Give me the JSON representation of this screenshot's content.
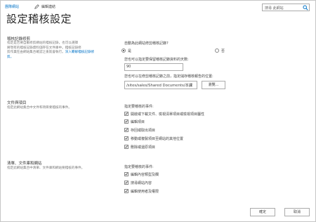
{
  "topbar": {
    "home_link": "團隊網站",
    "edit_links": "編輯連結"
  },
  "search": {
    "placeholder": "搜尋 此網站"
  },
  "page_title": "設定稽核設定",
  "sections": {
    "log_trimming": {
      "heading": "稽核記錄修剪",
      "description_parts": [
        "指定是否要自動修剪網站的稽核記錄，也可以選擇",
        "將現有的稽核記錄資料儲存在文件庫中。稽核記錄修",
        "剪作業在由網站集合確認之後就會執行。",
        "深入瞭解稽核記錄修",
        "剪。"
      ],
      "question": "自動為此網站修剪稽核記錄?",
      "radio_yes": "是",
      "radio_no": "否",
      "days_label": "您也可以指定要保留稽核記錄資料的天數:",
      "days_value": "90",
      "location_label": "您也可以在修剪稽核記錄之前，指定儲存稽核報告的位置:",
      "location_value": "/sites/sales/Shared Documents/本課",
      "browse_label": "瀏覽..."
    },
    "documents": {
      "heading": "文件與項目",
      "description": "指定此網站集合中文件和項目要稽核的事件。",
      "events_label": "指定要稽核的事件:",
      "events": [
        {
          "label": "開啟或下載文件、檢視清單項目或檢視項目屬性",
          "checked": true
        },
        {
          "label": "編輯項目",
          "checked": true
        },
        {
          "label": "存回或取出項目",
          "checked": true
        },
        {
          "label": "移動或複製項目至網站的其他位置",
          "checked": true
        },
        {
          "label": "刪除或還原項目",
          "checked": true
        }
      ]
    },
    "lists": {
      "heading": "清單、文件庫和網站",
      "description": "指定此網站集合中清單、文件庫和網站要稽核的事件。",
      "events_label": "指定要稽核的事件:",
      "events": [
        {
          "label": "編輯內容類型及欄",
          "checked": true
        },
        {
          "label": "搜尋網站內容",
          "checked": true
        },
        {
          "label": "編輯使用者及權限",
          "checked": true
        }
      ]
    }
  },
  "footer": {
    "ok_label": "確定",
    "cancel_label": "取消"
  }
}
